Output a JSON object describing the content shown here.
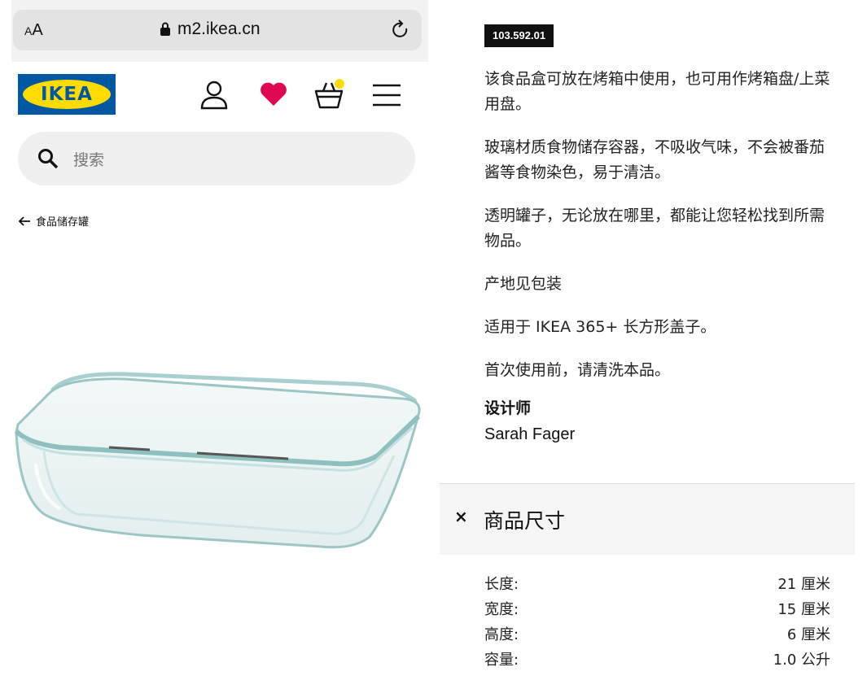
{
  "browser": {
    "aa_label": "AA",
    "url": "m2.ikea.cn"
  },
  "header": {
    "logo_text": "IKEA",
    "icons": [
      "user-icon",
      "heart-icon",
      "shopping-bag-icon",
      "menu-icon"
    ],
    "colors": {
      "brand_blue": "#0058a3",
      "brand_yellow": "#ffdb00",
      "heart_red": "#e00751",
      "cart_badge": "#ffdb00"
    }
  },
  "search": {
    "placeholder": "搜索"
  },
  "breadcrumb": {
    "label": "食品储存罐"
  },
  "product": {
    "sku": "103.592.01",
    "description": [
      "该食品盒可放在烤箱中使用，也可用作烤箱盘/上菜用盘。",
      "玻璃材质食物储存容器，不吸收气味，不会被番茄酱等食物染色，易于清洁。",
      "透明罐子，无论放在哪里，都能让您轻松找到所需物品。",
      "产地见包装",
      "适用于 IKEA 365+ 长方形盖子。",
      "首次使用前，请清洗本品。"
    ],
    "designer_heading": "设计师",
    "designer_name": "Sarah Fager"
  },
  "dimensions": {
    "toggle": "×",
    "title": "商品尺寸",
    "rows": [
      {
        "label": "长度:",
        "value": "21 厘米"
      },
      {
        "label": "宽度:",
        "value": "15 厘米"
      },
      {
        "label": "高度:",
        "value": "6 厘米"
      },
      {
        "label": "容量:",
        "value": "1.0 公升"
      }
    ]
  }
}
